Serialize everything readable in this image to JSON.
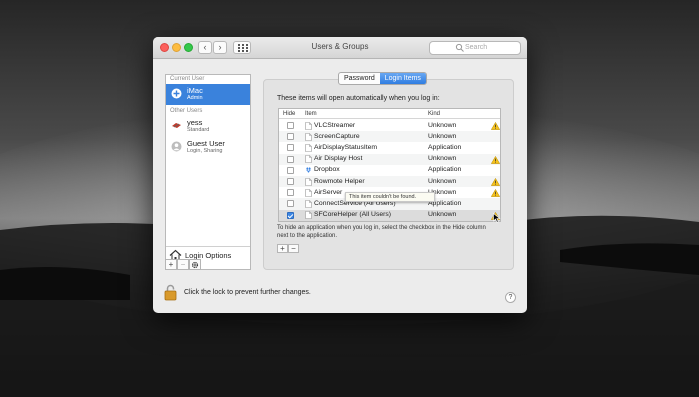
{
  "window": {
    "title": "Users & Groups",
    "search_placeholder": "Search"
  },
  "nav": {
    "back": "‹",
    "forward": "›"
  },
  "sidebar": {
    "current_user_header": "Current User",
    "current_user": {
      "name": "iMac",
      "role": "Admin"
    },
    "other_users_header": "Other Users",
    "other_users": [
      {
        "name": "yess",
        "role": "Standard"
      },
      {
        "name": "Guest User",
        "role": "Login, Sharing"
      }
    ],
    "login_options": "Login Options",
    "add": "+",
    "remove": "−"
  },
  "tabs": [
    "Password",
    "Login Items"
  ],
  "active_tab": "Login Items",
  "login_items": {
    "intro": "These items will open automatically when you log in:",
    "headers": {
      "hide": "Hide",
      "item": "Item",
      "kind": "Kind"
    },
    "rows": [
      {
        "name": "VLCStreamer",
        "kind": "Unknown",
        "hide": false,
        "warning": true
      },
      {
        "name": "ScreenCapture",
        "kind": "Unknown",
        "hide": false,
        "warning": false
      },
      {
        "name": "AirDisplayStatusItem",
        "kind": "Application",
        "hide": false,
        "warning": false
      },
      {
        "name": "Air Display Host",
        "kind": "Unknown",
        "hide": false,
        "warning": true
      },
      {
        "name": "Dropbox",
        "kind": "Application",
        "hide": false,
        "warning": false
      },
      {
        "name": "Rowmote Helper",
        "kind": "Unknown",
        "hide": false,
        "warning": true
      },
      {
        "name": "AirServer",
        "kind": "Unknown",
        "hide": false,
        "warning": true
      },
      {
        "name": "ConnectService (All Users)",
        "kind": "Application",
        "hide": false,
        "warning": false
      },
      {
        "name": "SFCoreHelper (All Users)",
        "kind": "Unknown",
        "hide": true,
        "warning": true
      }
    ],
    "hint": "To hide an application when you log in, select the checkbox in the Hide column next to the application.",
    "add": "+",
    "remove": "−",
    "tooltip": "This item couldn't be found."
  },
  "lock_text": "Click the lock to prevent further changes.",
  "help": "?"
}
